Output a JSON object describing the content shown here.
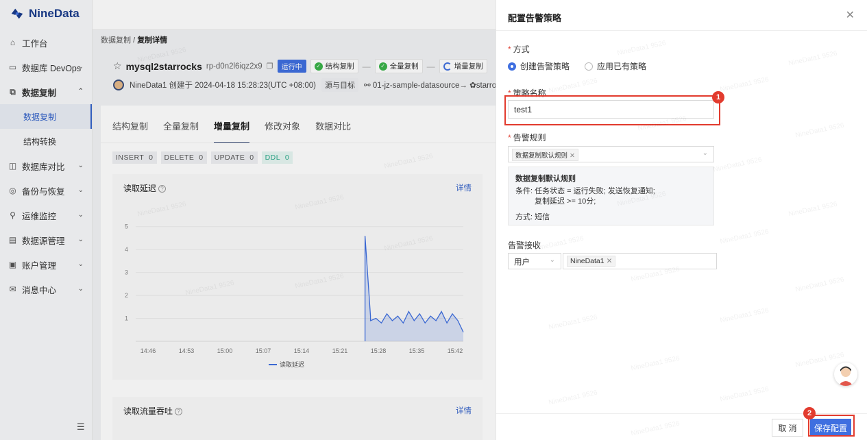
{
  "brand": {
    "name": "NineData"
  },
  "sidebar": {
    "items": [
      {
        "label": "工作台",
        "icon": "home-icon"
      },
      {
        "label": "数据库 DevOps",
        "icon": "monitor-icon"
      },
      {
        "label": "数据复制",
        "icon": "replication-icon"
      },
      {
        "label": "数据复制"
      },
      {
        "label": "结构转换"
      },
      {
        "label": "数据库对比",
        "icon": "compare-icon"
      },
      {
        "label": "备份与恢复",
        "icon": "backup-icon"
      },
      {
        "label": "运维监控",
        "icon": "ops-icon"
      },
      {
        "label": "数据源管理",
        "icon": "datasource-icon"
      },
      {
        "label": "账户管理",
        "icon": "account-icon"
      },
      {
        "label": "消息中心",
        "icon": "message-icon"
      }
    ]
  },
  "breadcrumb": {
    "parent": "数据复制",
    "sep": "/",
    "current": "复制详情"
  },
  "task": {
    "name": "mysql2starrocks",
    "id": "rp-d0n2l6iqz2x9",
    "status": "运行中",
    "steps": [
      "结构复制",
      "全量复制",
      "增量复制"
    ],
    "creator": "NineData1 创建于 2024-04-18 15:28:23(UTC +08:00)",
    "src_label": "源与目标",
    "route": "01-jz-sample-datasource→",
    "target": "starroc"
  },
  "tabs": [
    "结构复制",
    "全量复制",
    "增量复制",
    "修改对象",
    "数据对比"
  ],
  "counters": [
    {
      "label": "INSERT",
      "value": "0"
    },
    {
      "label": "DELETE",
      "value": "0"
    },
    {
      "label": "UPDATE",
      "value": "0"
    },
    {
      "label": "DDL",
      "value": "0"
    }
  ],
  "panels": {
    "latency": {
      "title": "读取延迟",
      "link": "详情"
    },
    "throughput": {
      "title": "读取流量吞吐",
      "link": "详情"
    }
  },
  "chart_data": {
    "type": "line",
    "x": [
      "14:46",
      "14:53",
      "15:00",
      "15:07",
      "15:14",
      "15:21",
      "15:28",
      "15:35",
      "15:42"
    ],
    "yticks": [
      1,
      2,
      3,
      4,
      5
    ],
    "ylim": [
      0,
      5.5
    ],
    "series": [
      {
        "name": "读取延迟",
        "color": "#3f6fe0",
        "points": [
          [
            15.28,
            0
          ],
          [
            15.28,
            4.6
          ],
          [
            15.285,
            1.1
          ],
          [
            15.29,
            0.9
          ],
          [
            15.3,
            1.0
          ],
          [
            15.31,
            0.8
          ],
          [
            15.32,
            1.2
          ],
          [
            15.33,
            0.9
          ],
          [
            15.34,
            1.1
          ],
          [
            15.35,
            0.8
          ],
          [
            15.36,
            1.3
          ],
          [
            15.37,
            0.9
          ],
          [
            15.38,
            1.2
          ],
          [
            15.39,
            0.8
          ],
          [
            15.4,
            1.1
          ],
          [
            15.41,
            0.9
          ],
          [
            15.42,
            1.3
          ],
          [
            15.43,
            0.8
          ],
          [
            15.44,
            1.2
          ],
          [
            15.45,
            0.9
          ],
          [
            15.46,
            0.4
          ]
        ]
      }
    ]
  },
  "drawer": {
    "title": "配置告警策略",
    "close": "✕",
    "mode_label": "方式",
    "mode_options": [
      "创建告警策略",
      "应用已有策略"
    ],
    "name_label": "策略名称",
    "name_value": "test1",
    "rules_label": "告警规则",
    "rule_chip": "数据复制默认规则",
    "rule_title": "数据复制默认规则",
    "rule_cond": "条件: 任务状态 = 运行失败; 发送恢复通知;",
    "rule_cond2": "复制延迟 >= 10分;",
    "rule_method": "方式: 短信",
    "recv_label": "告警接收",
    "recv_type": "用户",
    "recv_user": "NineData1",
    "cancel": "取 消",
    "save": "保存配置"
  },
  "annotations": {
    "badge1": "1",
    "badge2": "2"
  },
  "watermark": "NineData1 9526"
}
